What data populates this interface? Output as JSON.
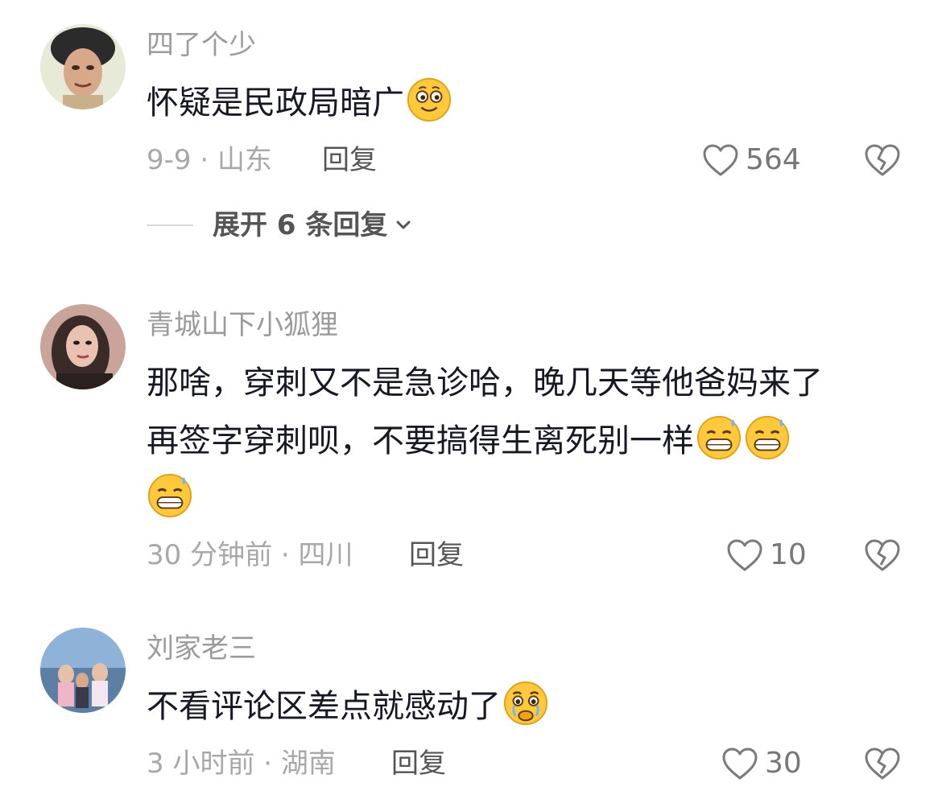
{
  "comments": [
    {
      "username": "四了个少",
      "text": "怀疑是民政局暗广",
      "emojis": [
        "smile-emoji"
      ],
      "date": "9-9",
      "location": "山东",
      "meta": "9-9 · 山东",
      "reply_label": "回复",
      "likes": "564",
      "expand_label": "展开 6 条回复"
    },
    {
      "username": "青城山下小狐狸",
      "text_line1": "那啥，穿刺又不是急诊哈，晚几天等他爸妈来了",
      "text_line2": "再签字穿刺呗，不要搞得生离死别一样",
      "emojis": [
        "grimace-sweat-emoji",
        "grimace-sweat-emoji",
        "grimace-sweat-emoji"
      ],
      "meta": "30 分钟前 · 四川",
      "reply_label": "回复",
      "likes": "10"
    },
    {
      "username": "刘家老三",
      "text": "不看评论区差点就感动了",
      "emojis": [
        "moved-tears-emoji"
      ],
      "meta": "3 小时前 · 湖南",
      "reply_label": "回复",
      "likes": "30"
    }
  ],
  "colors": {
    "text_primary": "#161823",
    "text_secondary": "#9b9b9b",
    "reply": "#555555",
    "emoji_yellow": "#ffc83d"
  }
}
